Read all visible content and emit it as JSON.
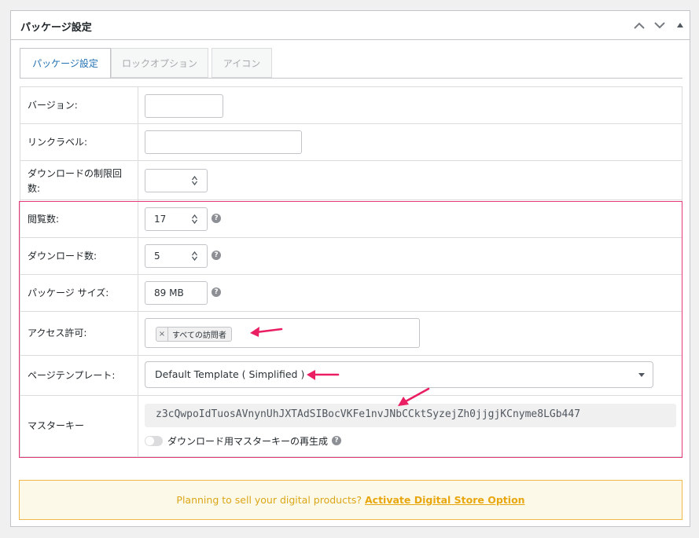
{
  "metabox": {
    "title": "パッケージ設定",
    "controls": [
      "chevron-up",
      "chevron-down",
      "caret-up"
    ]
  },
  "tabs": [
    {
      "label": "パッケージ設定",
      "active": true
    },
    {
      "label": "ロックオプション",
      "active": false
    },
    {
      "label": "アイコン",
      "active": false
    }
  ],
  "fields": {
    "version": {
      "label": "バージョン:",
      "value": ""
    },
    "link_label": {
      "label": "リンクラベル:",
      "value": ""
    },
    "download_limit": {
      "label_line1": "ダウンロードの制限回",
      "label_line2": "数:",
      "value": ""
    },
    "views": {
      "label": "閲覧数:",
      "value": "17"
    },
    "downloads": {
      "label": "ダウンロード数:",
      "value": "5"
    },
    "package_size": {
      "label": "パッケージ サイズ:",
      "value": "89 MB"
    },
    "access": {
      "label": "アクセス許可:",
      "chips": [
        {
          "remove": "×",
          "label": "すべての訪問者"
        }
      ]
    },
    "page_template": {
      "label": "ページテンプレート:",
      "selected": "Default Template ( Simplified )"
    },
    "master_key": {
      "label": "マスターキー",
      "value": "z3cQwpoIdTuosAVnynUhJXTAdSIBocVKFe1nvJNbCCktSyzejZh0jjgjKCnyme8LGb447",
      "regenerate_label": "ダウンロード用マスターキーの再生成",
      "regenerate_enabled": false
    }
  },
  "help_icon_text": "?",
  "promo": {
    "text": "Planning to sell your digital products? ",
    "link": "Activate Digital Store Option"
  },
  "colors": {
    "highlight_border": "#e6397a",
    "annotation_arrow": "#e91e63",
    "tab_active_text": "#2271b1",
    "promo_background": "#fcf9e8",
    "promo_border": "#f0b849",
    "promo_text": "#dba617"
  }
}
